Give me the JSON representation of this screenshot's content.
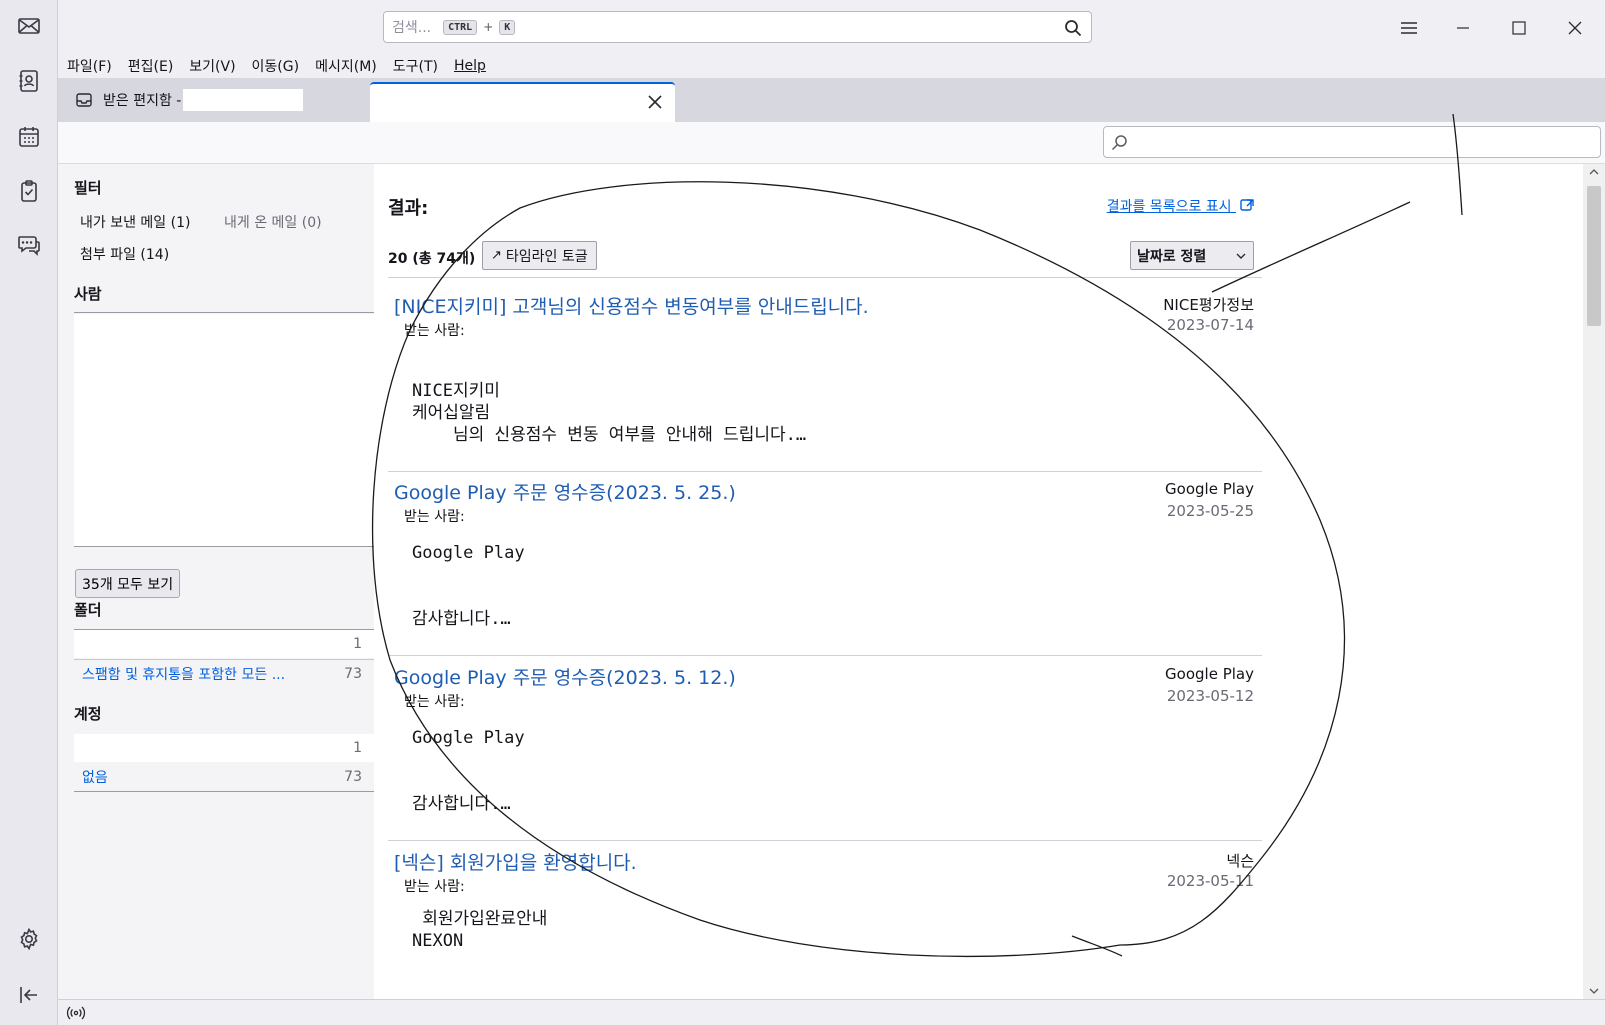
{
  "colors": {
    "accent": "#0060df",
    "subject_link": "#1f5db3",
    "tab_indicator": "#0061e0"
  },
  "spaces": [
    "mail-icon",
    "address-book-icon",
    "calendar-icon",
    "tasks-icon",
    "chat-icon",
    "settings-icon",
    "collapse-icon"
  ],
  "search": {
    "placeholder": "검색...",
    "key1": "CTRL",
    "plus": "+",
    "key2": "K"
  },
  "menu": [
    "파일(F)",
    "편집(E)",
    "보기(V)",
    "이동(G)",
    "메시지(M)",
    "도구(T)",
    "Help"
  ],
  "tab": {
    "title": "받은 편지함 -"
  },
  "sidebar": {
    "filter_head": "필터",
    "sent_by_me": "내가 보낸 메일 (1)",
    "sent_to_me": "내게 온 메일 (0)",
    "attachments": "첨부 파일 (14)",
    "people_head": "사람",
    "show_all": "35개 모두 보기",
    "folder_head": "폴더",
    "folders": [
      {
        "name": "",
        "count": "1"
      },
      {
        "name": "스팸함 및 휴지통을 포함한 모든 ...",
        "count": "73"
      }
    ],
    "account_head": "계정",
    "accounts": [
      {
        "name": "",
        "count": "1"
      },
      {
        "name": "없음",
        "count": "73"
      }
    ]
  },
  "results": {
    "title": "결과:",
    "list_link": "결과를 목록으로 표시",
    "count": "20 (총 74개)",
    "timeline": "타임라인 토글",
    "sort": "날짜로 정렬",
    "messages": [
      {
        "subject": "[NICE지키미] 고객님의 신용점수 변동여부를 안내드립니다.",
        "to": "받는 사람:",
        "from": "NICE평가정보",
        "date": "2023-07-14",
        "body": [
          "NICE지키미",
          "케어십알림",
          "    님의 신용점수 변동 여부를 안내해 드립니다.…"
        ]
      },
      {
        "subject": "Google Play 주문 영수증(2023. 5. 25.)",
        "to": "받는 사람:",
        "from": "Google Play",
        "date": "2023-05-25",
        "body": [
          "Google Play",
          "",
          "",
          "감사합니다.…"
        ]
      },
      {
        "subject": "Google Play 주문 영수증(2023. 5. 12.)",
        "to": "받는 사람:",
        "from": "Google Play",
        "date": "2023-05-12",
        "body": [
          "Google Play",
          "",
          "",
          "감사합니다.…"
        ]
      },
      {
        "subject": "[넥슨] 회원가입을 환영합니다.",
        "to": "받는 사람:",
        "from": "넥슨",
        "date": "2023-05-11",
        "body": [
          " 회원가입완료안내",
          "NEXON"
        ]
      }
    ]
  }
}
